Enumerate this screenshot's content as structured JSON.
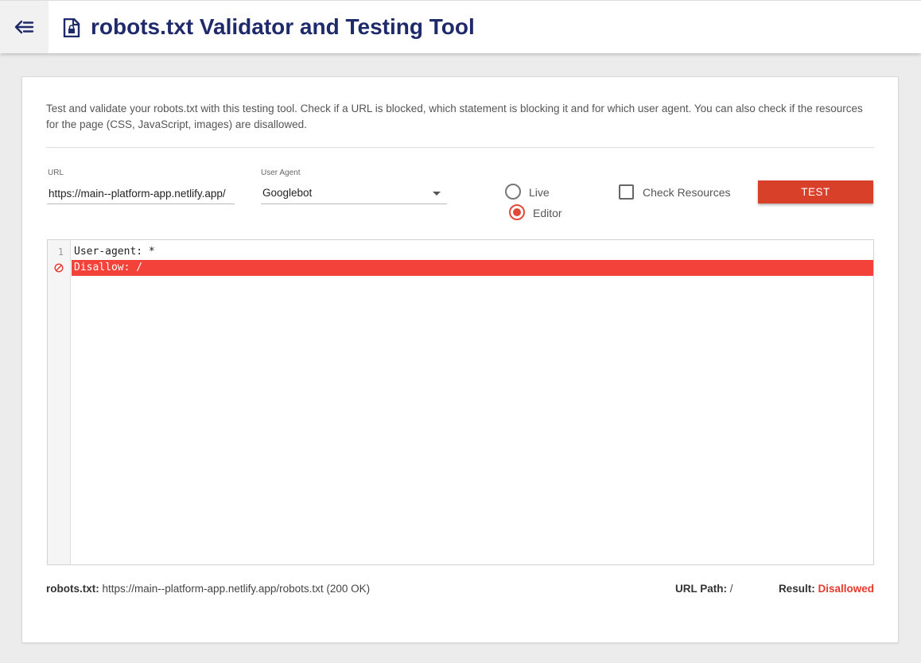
{
  "header": {
    "back_icon": "arrow-back-menu-icon",
    "title_icon": "locked-document-icon",
    "title": "robots.txt Validator and Testing Tool"
  },
  "description": "Test and validate your robots.txt with this testing tool. Check if a URL is blocked, which statement is blocking it and for which user agent. You can also check if the resources for the page (CSS, JavaScript, images) are disallowed.",
  "form": {
    "url_label": "URL",
    "url_value": "https://main--platform-app.netlify.app/",
    "user_agent_label": "User Agent",
    "user_agent_value": "Googlebot",
    "mode_options": [
      {
        "label": "Live",
        "selected": false
      },
      {
        "label": "Editor",
        "selected": true
      }
    ],
    "check_resources_label": "Check Resources",
    "check_resources_checked": false,
    "test_button": "TEST"
  },
  "editor": {
    "lines": [
      {
        "number": "1",
        "text": "User-agent: *",
        "blocked": false
      },
      {
        "number": "",
        "text": "Disallow: /",
        "blocked": true,
        "marker_icon": "blocked-circle-icon"
      }
    ]
  },
  "footer": {
    "robots_label": "robots.txt:",
    "robots_value": "https://main--platform-app.netlify.app/robots.txt (200 OK)",
    "url_path_label": "URL Path:",
    "url_path_value": "/",
    "result_label": "Result:",
    "result_value": "Disallowed"
  },
  "colors": {
    "title": "#1f2a6b",
    "accent": "#d9402a",
    "blocked_line": "#f2423a",
    "disallowed_text": "#e8382c"
  }
}
